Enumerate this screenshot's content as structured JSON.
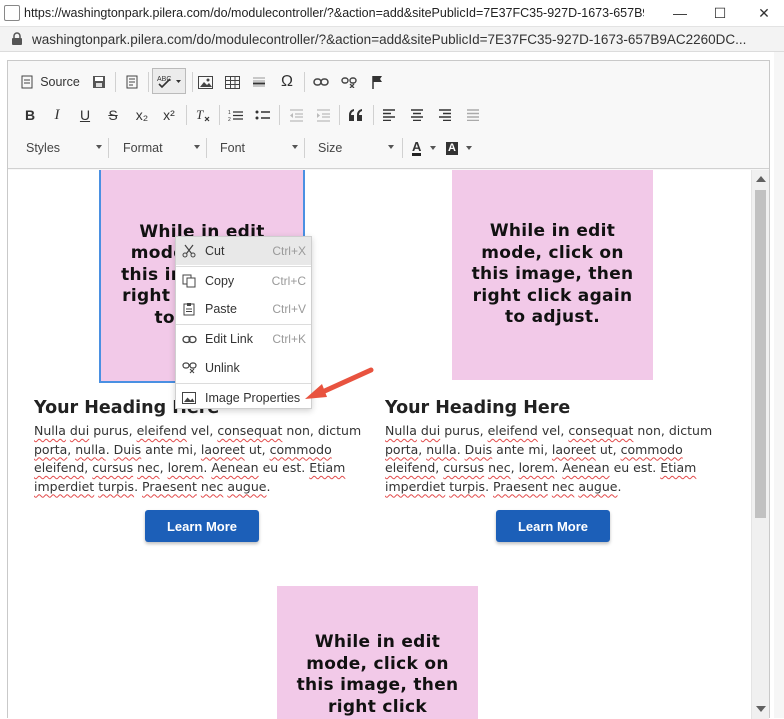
{
  "window": {
    "title": "https://washingtonpark.pilera.com/do/modulecontroller/?&action=add&sitePublicId=7E37FC35-927D-1673-657B9A...",
    "minimize_glyph": "—",
    "maximize_glyph": "☐",
    "close_glyph": "✕"
  },
  "address": {
    "url": "washingtonpark.pilera.com/do/modulecontroller/?&action=add&sitePublicId=7E37FC35-927D-1673-657B9AC2260DC..."
  },
  "toolbar": {
    "source_label": "Source",
    "icons": [
      "save-icon",
      "templates-icon",
      "spellcheck-icon",
      "image-icon",
      "table-icon",
      "horizontal-line-icon",
      "special-char-icon",
      "link-icon",
      "unlink-icon",
      "anchor-icon",
      "bold-icon",
      "italic-icon",
      "underline-icon",
      "strike-icon",
      "subscript-icon",
      "superscript-icon",
      "remove-format-icon",
      "numbered-list-icon",
      "bulleted-list-icon",
      "outdent-icon",
      "indent-icon",
      "blockquote-icon",
      "align-left-icon",
      "align-center-icon",
      "align-right-icon",
      "justify-icon",
      "text-color-icon",
      "background-color-icon"
    ],
    "bold_glyph": "B",
    "italic_glyph": "I",
    "underline_glyph": "U",
    "strike_glyph": "S",
    "subscript_glyph": "x₂",
    "superscript_glyph": "x²",
    "special_char_glyph": "Ω",
    "text_color_glyph": "A",
    "dropdowns": {
      "styles": "Styles",
      "format": "Format",
      "font": "Font",
      "size": "Size"
    }
  },
  "content": {
    "promo_text": "While in edit mode, click on this image, then right click again to adjust.",
    "promo_text_partial": "While in edit mode this then again",
    "left": {
      "heading": "Your Heading Here",
      "paragraph": "Nulla dui purus, eleifend vel, consequat non, dictum porta, nulla. Duis ante mi, laoreet ut, commodo eleifend, cursus nec, lorem. Aenean eu est. Etiam imperdiet turpis. Praesent nec augue.",
      "button": "Learn More"
    },
    "right": {
      "heading": "Your Heading Here",
      "paragraph": "Nulla dui purus, eleifend vel, consequat non, dictum porta, nulla. Duis ante mi, laoreet ut, commodo eleifend, cursus nec, lorem. Aenean eu est. Etiam imperdiet turpis. Praesent nec augue.",
      "button": "Learn More"
    },
    "bottom_promo_text": "While in edit mode, click on this image, then right click"
  },
  "context_menu": {
    "items": [
      {
        "label": "Cut",
        "shortcut": "Ctrl+X",
        "icon": "scissors-icon"
      },
      {
        "label": "Copy",
        "shortcut": "Ctrl+C",
        "icon": "copy-icon"
      },
      {
        "label": "Paste",
        "shortcut": "Ctrl+V",
        "icon": "paste-icon"
      },
      {
        "label": "Edit Link",
        "shortcut": "Ctrl+K",
        "icon": "link-icon"
      },
      {
        "label": "Unlink",
        "shortcut": "",
        "icon": "unlink-icon"
      },
      {
        "label": "Image Properties",
        "shortcut": "",
        "icon": "image-icon"
      }
    ]
  },
  "colors": {
    "promo_background": "#f2c9e8",
    "button_background": "#1c5fb8",
    "arrow": "#e8533f",
    "selection_outline": "#4a90e2"
  }
}
